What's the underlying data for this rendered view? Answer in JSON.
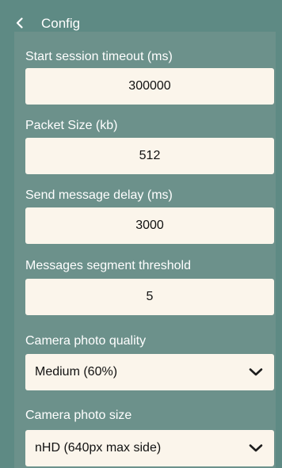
{
  "header": {
    "title": "Config",
    "back_icon": "chevron-left-icon"
  },
  "fields": [
    {
      "label": "Start session timeout (ms)",
      "value": "300000"
    },
    {
      "label": "Packet Size (kb)",
      "value": "512"
    },
    {
      "label": "Send message delay (ms)",
      "value": "3000"
    },
    {
      "label": "Messages segment threshold",
      "value": "5"
    }
  ],
  "camera": {
    "quality_label": "Camera photo quality",
    "quality_value": "Medium (60%)",
    "size_label": "Camera photo size",
    "size_value": "nHD (640px max side)",
    "dropdown_icon": "chevron-down-icon"
  },
  "colors": {
    "background": "#5e8a84",
    "panel": "#6c918b",
    "field": "#fbf5eb",
    "text": "#ffffff",
    "input_text": "#111111"
  }
}
